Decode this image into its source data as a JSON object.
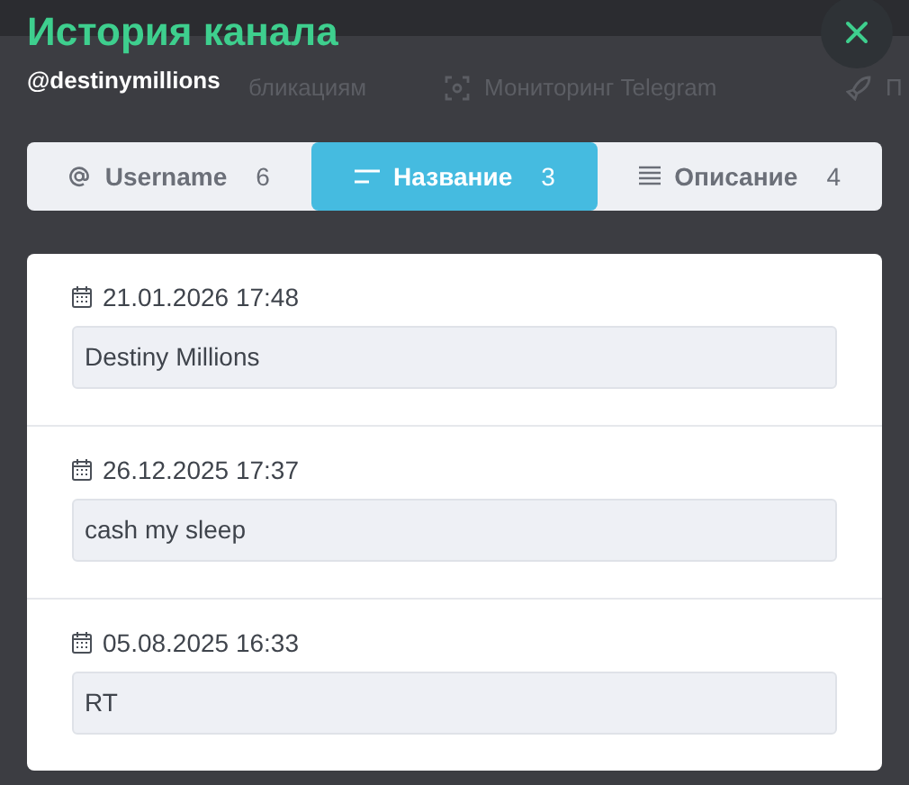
{
  "background_nav": [
    {
      "kind": "text",
      "label": "бликациям"
    },
    {
      "kind": "monitor",
      "label": "Мониторинг Telegram"
    },
    {
      "kind": "rocket",
      "label": "П"
    }
  ],
  "dialog": {
    "title": "История канала",
    "subtitle": "@destinymillions"
  },
  "tabs": [
    {
      "kind": "at",
      "label": "Username",
      "count": "6",
      "selected": false
    },
    {
      "kind": "lines",
      "label": "Название",
      "count": "3",
      "selected": true
    },
    {
      "kind": "text",
      "label": "Описание",
      "count": "4",
      "selected": false
    }
  ],
  "entries": [
    {
      "date": "21.01.2026 17:48",
      "value": "Destiny Millions"
    },
    {
      "date": "26.12.2025 17:37",
      "value": "cash my sleep"
    },
    {
      "date": "05.08.2025 16:33",
      "value": "RT"
    }
  ]
}
